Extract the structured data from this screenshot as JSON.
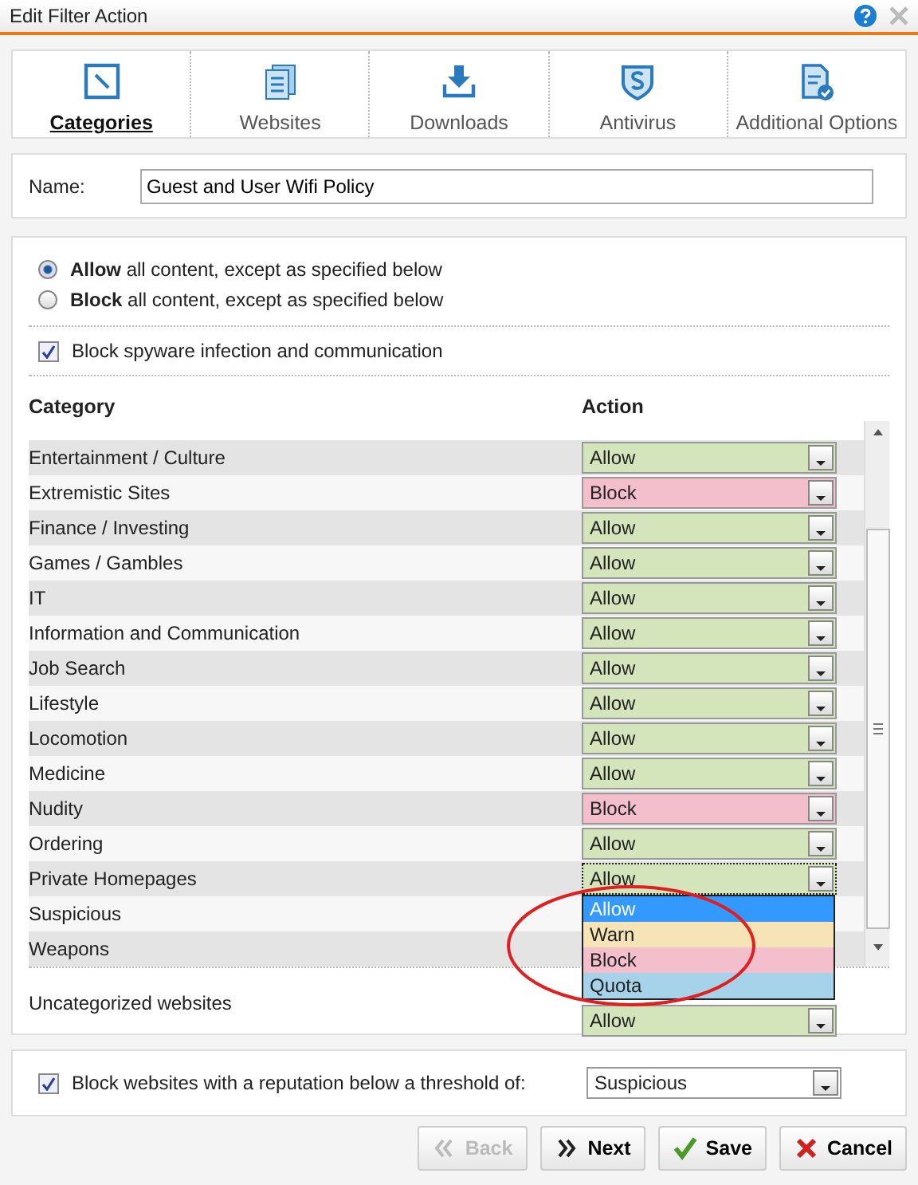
{
  "window": {
    "title": "Edit Filter Action"
  },
  "tabs": [
    {
      "label": "Categories",
      "kind": "categories",
      "selected": true
    },
    {
      "label": "Websites",
      "kind": "websites",
      "selected": false
    },
    {
      "label": "Downloads",
      "kind": "downloads",
      "selected": false
    },
    {
      "label": "Antivirus",
      "kind": "antivirus",
      "selected": false
    },
    {
      "label": "Additional Options",
      "kind": "options",
      "selected": false
    }
  ],
  "name_field": {
    "label": "Name:",
    "value": "Guest and User Wifi Policy"
  },
  "modes": [
    {
      "label": "**Allow** all content, except as specified below",
      "selected": true
    },
    {
      "label": "**Block** all content, except as specified below",
      "selected": false
    }
  ],
  "spyware": {
    "label": "Block spyware infection and communication",
    "checked": true
  },
  "table": {
    "columns": [
      "Category",
      "Action"
    ],
    "rows": [
      {
        "category": "Entertainment / Culture",
        "action": "Allow",
        "color": "#d4e5bc"
      },
      {
        "category": "Extremistic Sites",
        "action": "Block",
        "color": "#f4bfcd"
      },
      {
        "category": "Finance / Investing",
        "action": "Allow",
        "color": "#d4e5bc"
      },
      {
        "category": "Games / Gambles",
        "action": "Allow",
        "color": "#d4e5bc"
      },
      {
        "category": "IT",
        "action": "Allow",
        "color": "#d4e5bc"
      },
      {
        "category": "Information and Communication",
        "action": "Allow",
        "color": "#d4e5bc"
      },
      {
        "category": "Job Search",
        "action": "Allow",
        "color": "#d4e5bc"
      },
      {
        "category": "Lifestyle",
        "action": "Allow",
        "color": "#d4e5bc"
      },
      {
        "category": "Locomotion",
        "action": "Allow",
        "color": "#d4e5bc"
      },
      {
        "category": "Medicine",
        "action": "Allow",
        "color": "#d4e5bc"
      },
      {
        "category": "Nudity",
        "action": "Block",
        "color": "#f4bfcd"
      },
      {
        "category": "Ordering",
        "action": "Allow",
        "color": "#d4e5bc"
      },
      {
        "category": "Private Homepages",
        "action": "Allow",
        "color": "#d4e5bc",
        "open": true
      },
      {
        "category": "Suspicious"
      },
      {
        "category": "Weapons"
      }
    ],
    "dropdown": [
      {
        "label": "Allow",
        "color": "#3399ff",
        "selected": true
      },
      {
        "label": "Warn",
        "color": "#f6e3b6",
        "selected": false
      },
      {
        "label": "Block",
        "color": "#f4bfcd",
        "selected": false
      },
      {
        "label": "Quota",
        "color": "#a6d2ea",
        "selected": false
      }
    ]
  },
  "uncategorized": {
    "category": "Uncategorized websites",
    "action": "Allow",
    "color": "#d4e5bc"
  },
  "reputation": {
    "label": "Block websites with a reputation below a threshold of:",
    "checked": true,
    "value": "Suspicious"
  },
  "buttons": [
    {
      "label": "Back",
      "kind": "back",
      "disabled": true
    },
    {
      "label": "Next",
      "kind": "next",
      "disabled": false
    },
    {
      "label": "Save",
      "kind": "save",
      "disabled": false
    },
    {
      "label": "Cancel",
      "kind": "cancel",
      "disabled": false
    }
  ]
}
